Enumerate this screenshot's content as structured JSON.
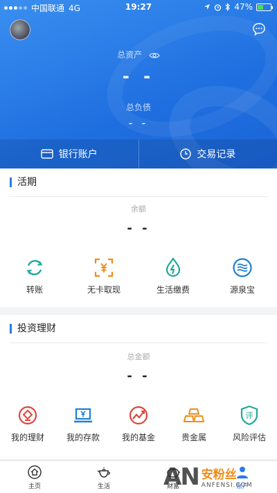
{
  "status_bar": {
    "carrier": "中国联通",
    "network": "4G",
    "time": "19:27",
    "battery": "47%",
    "battery_level": 0.47
  },
  "header": {
    "total_assets_label": "总资产",
    "total_assets_value": "- -",
    "total_debt_label": "总负债",
    "total_debt_value": "- -",
    "quick_links": [
      {
        "label": "银行账户",
        "icon": "card-icon"
      },
      {
        "label": "交易记录",
        "icon": "clock-icon"
      }
    ]
  },
  "demand_section": {
    "title": "活期",
    "balance_label": "余额",
    "balance_value": "- -",
    "actions": [
      {
        "label": "转账",
        "icon": "transfer-icon"
      },
      {
        "label": "无卡取现",
        "icon": "cardless-cash-icon"
      },
      {
        "label": "生活缴费",
        "icon": "utility-payment-icon"
      },
      {
        "label": "源泉宝",
        "icon": "wave-icon"
      }
    ]
  },
  "investment_section": {
    "title": "投资理财",
    "amount_label": "总金额",
    "amount_value": "- -",
    "actions": [
      {
        "label": "我的理财",
        "icon": "wealth-icon"
      },
      {
        "label": "我的存款",
        "icon": "deposit-icon"
      },
      {
        "label": "我的基金",
        "icon": "fund-icon"
      },
      {
        "label": "贵金属",
        "icon": "gold-bars-icon"
      },
      {
        "label": "风险评估",
        "icon": "risk-assessment-icon"
      }
    ]
  },
  "tabbar": {
    "tabs": [
      {
        "label": "主页",
        "icon": "home-icon"
      },
      {
        "label": "生活",
        "icon": "teapot-icon"
      },
      {
        "label": "财富",
        "icon": "piggy-bank-icon"
      },
      {
        "label": "账户",
        "icon": "user-icon"
      }
    ],
    "active_index": 3
  },
  "watermark": {
    "logo": "AN",
    "cn": "安粉丝",
    "en": "ANFENSI.COM"
  },
  "colors": {
    "primary": "#1f6fe0",
    "accent_orange": "#f08c18",
    "teal": "#1fa89a",
    "red": "#e0443c",
    "blue": "#2a7be6"
  }
}
